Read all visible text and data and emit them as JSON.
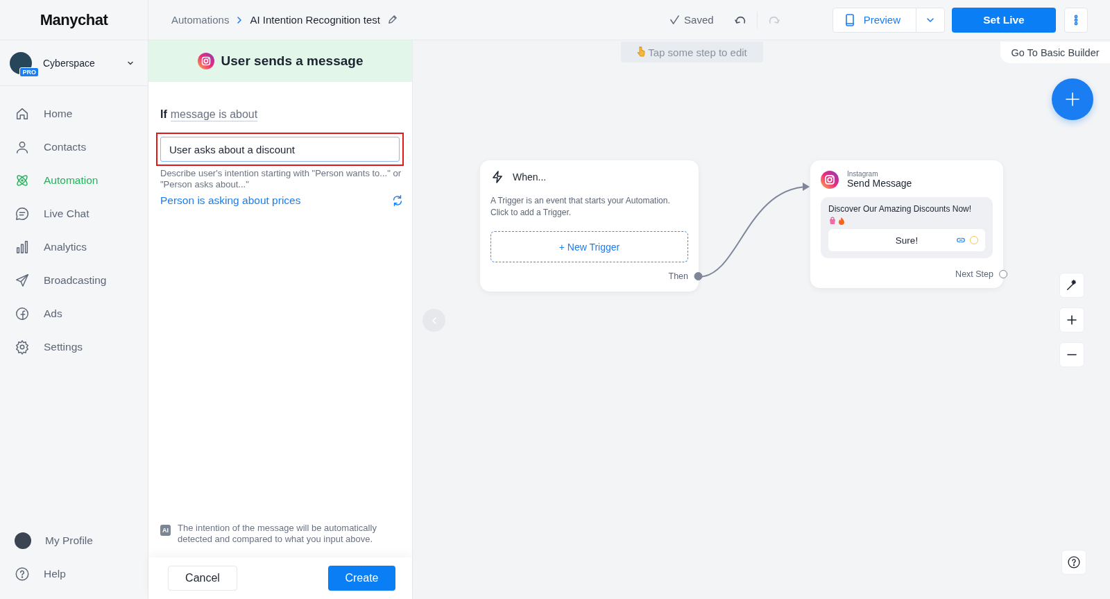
{
  "app": {
    "logo": "Manychat"
  },
  "account": {
    "name": "Cyberspace",
    "badge": "PRO"
  },
  "nav": [
    {
      "label": "Home",
      "selected": false
    },
    {
      "label": "Contacts",
      "selected": false
    },
    {
      "label": "Automation",
      "selected": true
    },
    {
      "label": "Live Chat",
      "selected": false
    },
    {
      "label": "Analytics",
      "selected": false
    },
    {
      "label": "Broadcasting",
      "selected": false
    },
    {
      "label": "Ads",
      "selected": false
    },
    {
      "label": "Settings",
      "selected": false
    }
  ],
  "nav_bottom": [
    {
      "label": "My Profile"
    },
    {
      "label": "Help"
    }
  ],
  "breadcrumb": {
    "parent": "Automations",
    "current": "AI Intention Recognition test"
  },
  "toolbar": {
    "status": "Saved",
    "preview": "Preview",
    "set_live": "Set Live"
  },
  "panel": {
    "title": "User sends a message",
    "condition_prefix": "If",
    "condition": "message is about",
    "input_value": "User asks about a discount",
    "hint": "Describe user's intention starting with \"Person wants to...\" or \"Person asks about...\"",
    "suggestion": "Person is asking about prices",
    "ai_badge": "AI",
    "ai_note": "The intention of the message will be automatically detected and compared to what you input above.",
    "cancel": "Cancel",
    "create": "Create"
  },
  "canvas": {
    "hint": "Tap some step to edit",
    "basic_builder": "Go To Basic Builder",
    "trigger_node": {
      "title": "When...",
      "description": "A Trigger is an event that starts your Automation. Click to add a Trigger.",
      "button": "+ New Trigger",
      "output": "Then"
    },
    "message_node": {
      "platform": "Instagram",
      "title": "Send Message",
      "message": "Discover Our Amazing Discounts Now!",
      "button": "Sure!",
      "output": "Next Step"
    }
  }
}
